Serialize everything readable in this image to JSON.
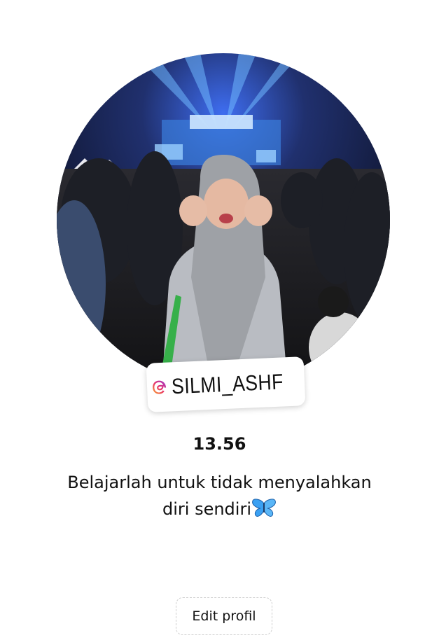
{
  "profile": {
    "avatar_description_icon": "profile-photo",
    "handle": "SILMI_ASHF",
    "threads_icon": "threads-icon",
    "stat_value": "13.56",
    "bio_line_1": "Belajarlah untuk tidak menyalahkan",
    "bio_line_2": "diri sendiri",
    "bio_emoji_icon": "butterfly-icon",
    "edit_button_label": "Edit profil"
  },
  "colors": {
    "threads_gradient_start": "#f9a42a",
    "threads_gradient_mid": "#e8336d",
    "threads_gradient_end": "#9b3bd0",
    "butterfly": "#3aa0f2"
  }
}
